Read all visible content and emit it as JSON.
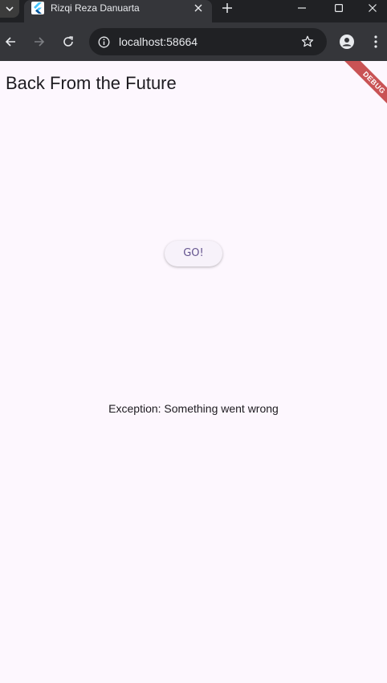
{
  "browser": {
    "tab_title": "Rizqi Reza Danuarta",
    "url": "localhost:58664"
  },
  "app": {
    "title": "Back From the Future",
    "debug_label": "DEBUG",
    "go_button_label": "GO!",
    "result_text": "Exception: Something went wrong"
  },
  "colors": {
    "background": "#fdf7fe",
    "button_text": "#65558f",
    "debug_banner": "#b71c1c",
    "chrome_dark": "#202124",
    "chrome_toolbar": "#35363a"
  },
  "icons": [
    "tab-search-icon",
    "flutter-favicon-icon",
    "close-icon",
    "plus-icon",
    "minimize-icon",
    "maximize-icon",
    "window-close-icon",
    "back-arrow-icon",
    "forward-arrow-icon",
    "reload-icon",
    "site-info-icon",
    "star-icon",
    "profile-icon",
    "kebab-menu-icon"
  ]
}
